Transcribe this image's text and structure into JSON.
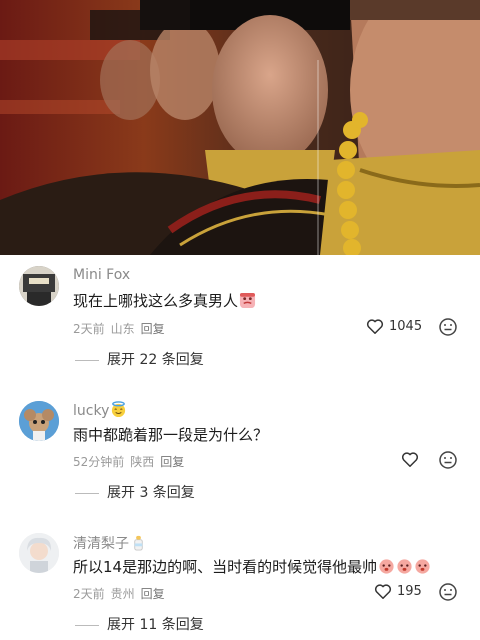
{
  "comments": [
    {
      "username": "Mini Fox",
      "text": "现在上哪找这么多真男人",
      "time": "2天前",
      "location": "山东",
      "reply_label": "回复",
      "likes": "1045",
      "expand": "展开 22 条回复"
    },
    {
      "username": "lucky",
      "text": "雨中都跪着那一段是为什么？",
      "time": "52分钟前",
      "location": "陕西",
      "reply_label": "回复",
      "likes": "",
      "expand": "展开 3 条回复"
    },
    {
      "username": "清清梨子",
      "text": "所以14是那边的啊、当时看的时候觉得他最帅",
      "time": "2天前",
      "location": "贵州",
      "reply_label": "回复",
      "likes": "195",
      "expand": "展开 11 条回复"
    }
  ],
  "icons": {
    "like": "heart-outline-icon",
    "more": "emoji-reaction-icon"
  }
}
